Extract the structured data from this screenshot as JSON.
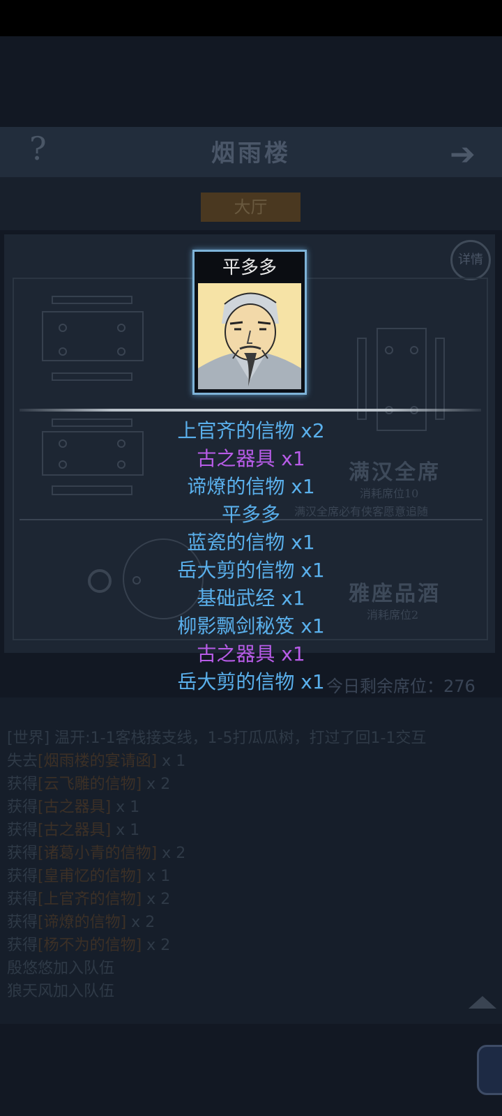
{
  "header": {
    "title": "烟雨楼",
    "help_icon": "?",
    "next_icon": "➔"
  },
  "tab": {
    "label": "大厅"
  },
  "detail": {
    "label": "详情"
  },
  "feasts": [
    {
      "name": "满汉全席",
      "cost": "消耗席位10",
      "note": "满汉全席必有侠客愿意追随"
    },
    {
      "name": "雅座品酒",
      "cost": "消耗席位2"
    }
  ],
  "remaining": "今日剩余席位：276",
  "log": [
    {
      "prefix": "[世界] ",
      "text": "温开:1-1客栈接支线，1-5打瓜瓜树，打过了回1-1交互"
    },
    {
      "prefix": "失去",
      "item": "[烟雨楼的宴请函]",
      "qty": " x 1"
    },
    {
      "prefix": "获得",
      "item": "[云飞雕的信物]",
      "qty": " x 2"
    },
    {
      "prefix": "获得",
      "item": "[古之器具]",
      "qty": " x 1"
    },
    {
      "prefix": "获得",
      "item": "[古之器具]",
      "qty": " x 1"
    },
    {
      "prefix": "获得",
      "item": "[诸葛小青的信物]",
      "qty": " x 2"
    },
    {
      "prefix": "获得",
      "item": "[皇甫忆的信物]",
      "qty": " x 1"
    },
    {
      "prefix": "获得",
      "item": "[上官齐的信物]",
      "qty": " x 2"
    },
    {
      "prefix": "获得",
      "item": "[谛燎的信物]",
      "qty": " x 2"
    },
    {
      "prefix": "获得",
      "item": "[杨不为的信物]",
      "qty": " x 2"
    },
    {
      "prefix": "",
      "text": "殷悠悠加入队伍"
    },
    {
      "prefix": "",
      "text": "狼天风加入队伍"
    }
  ],
  "popup": {
    "character_name": "平多多",
    "rewards": [
      {
        "text": "上官齐的信物 x2",
        "color": "#5ab0ec"
      },
      {
        "text": "古之器具 x1",
        "color": "#b85ce8"
      },
      {
        "text": "谛燎的信物 x1",
        "color": "#5ab0ec"
      },
      {
        "text": "平多多",
        "color": "#5ab0ec"
      },
      {
        "text": "蓝瓷的信物 x1",
        "color": "#5ab0ec"
      },
      {
        "text": "岳大剪的信物 x1",
        "color": "#5ab0ec"
      },
      {
        "text": "基础武经 x1",
        "color": "#5ab0ec"
      },
      {
        "text": "柳影飘剑秘笈 x1",
        "color": "#5ab0ec"
      },
      {
        "text": "古之器具 x1",
        "color": "#b85ce8"
      },
      {
        "text": "岳大剪的信物 x1",
        "color": "#5ab0ec"
      }
    ]
  }
}
